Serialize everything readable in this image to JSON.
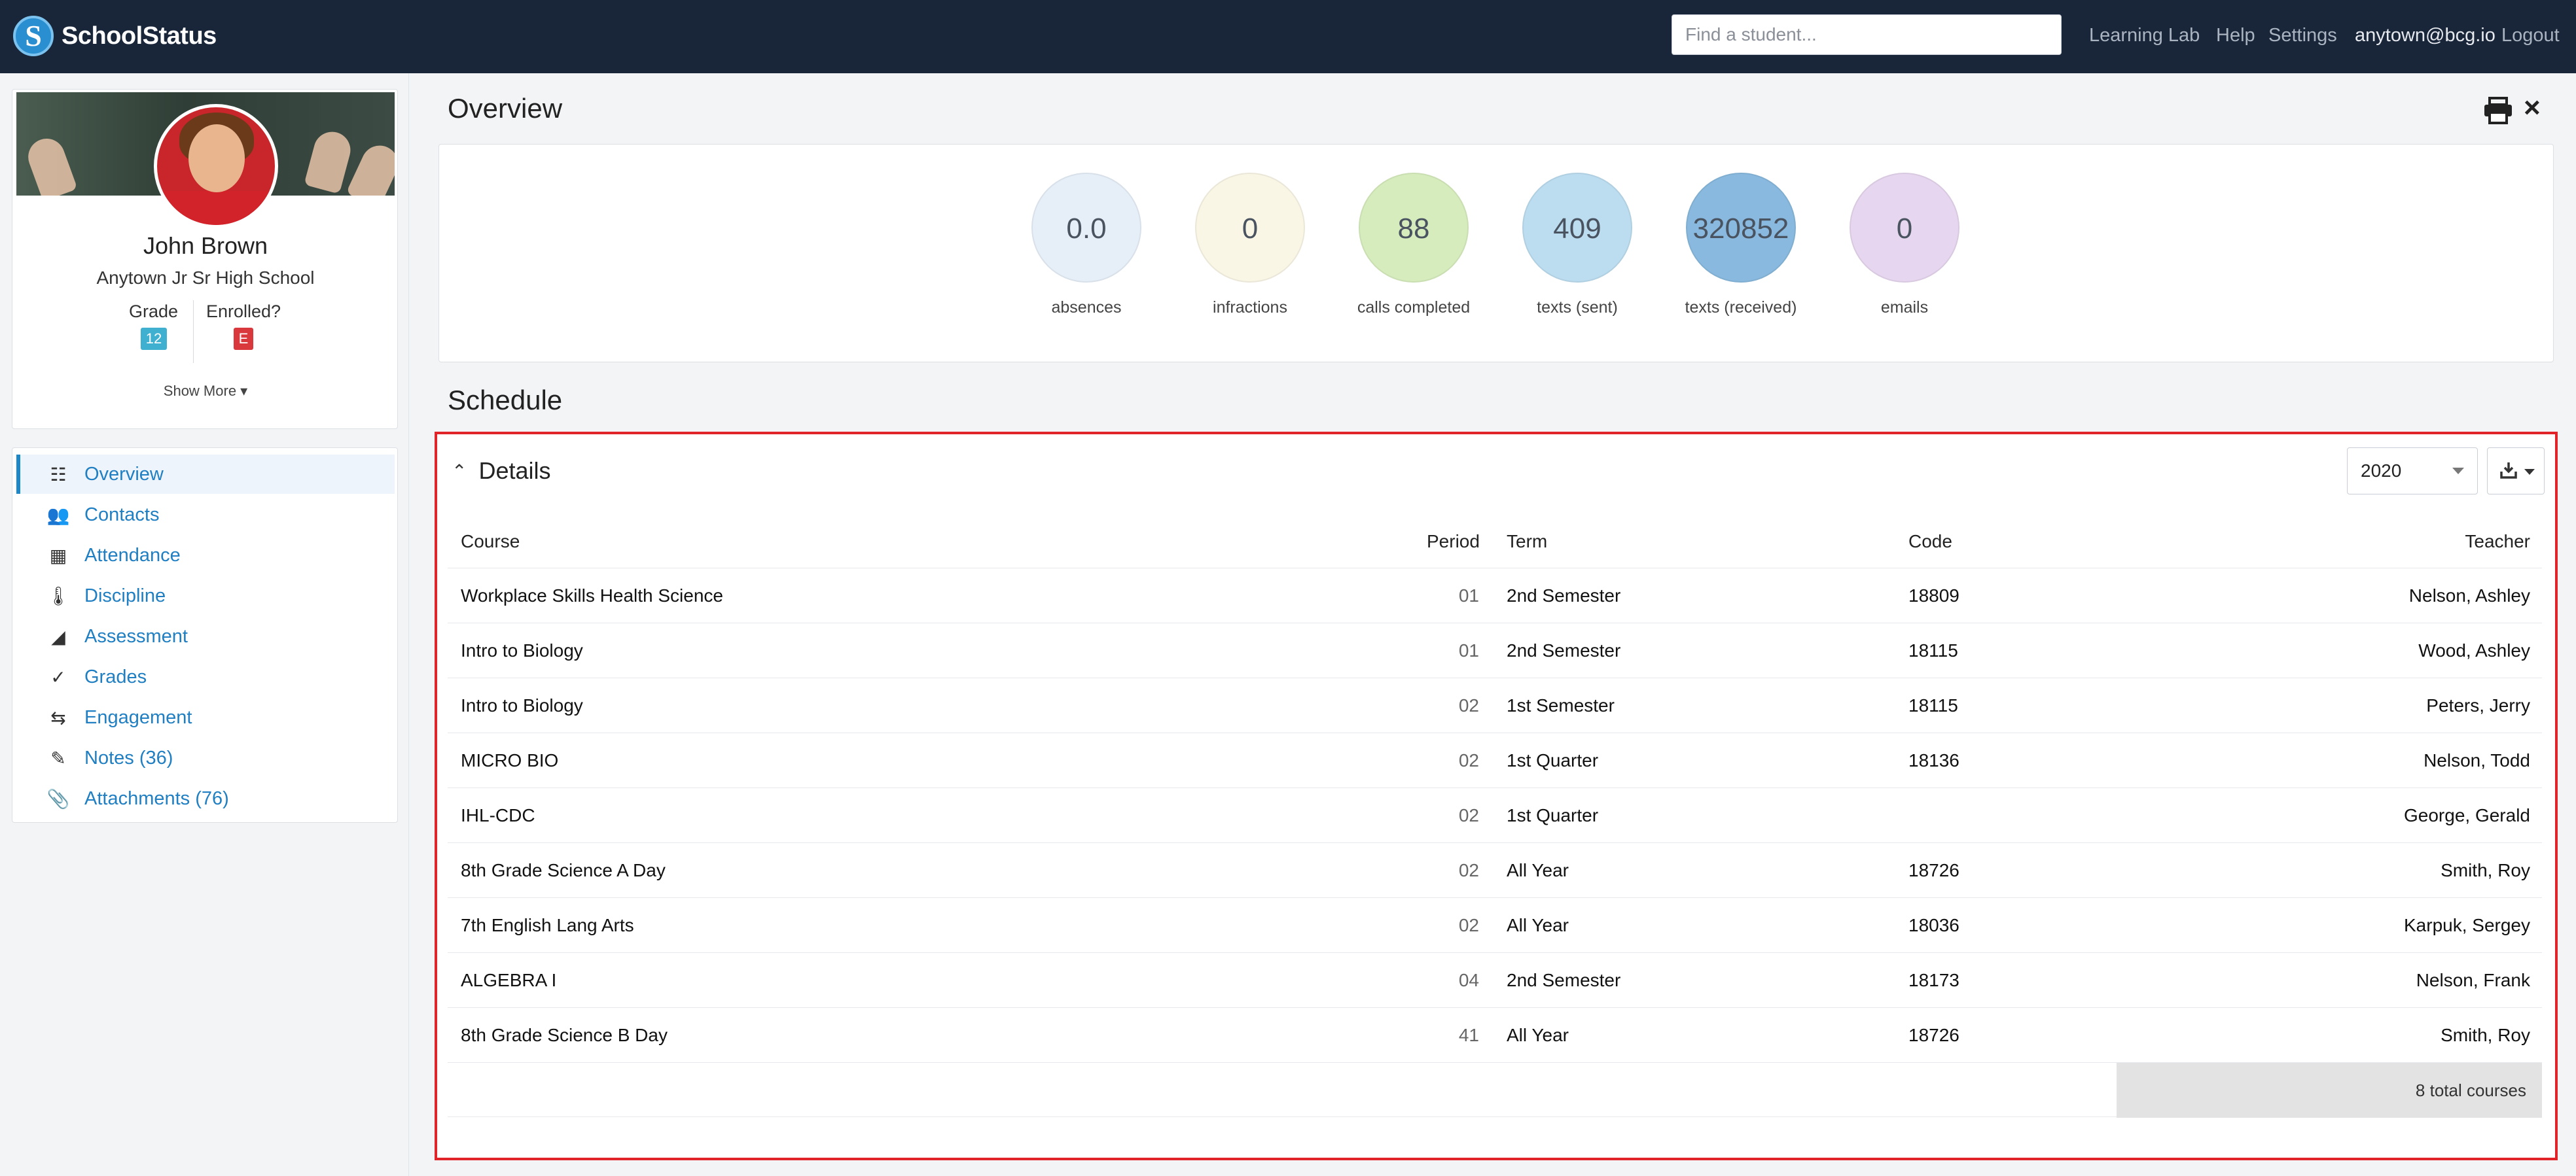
{
  "brand": {
    "name": "SchoolStatus"
  },
  "search": {
    "placeholder": "Find a student..."
  },
  "topnav": {
    "learning_lab": "Learning Lab",
    "help": "Help",
    "settings": "Settings",
    "user": "anytown@bcg.io",
    "logout": "Logout"
  },
  "student": {
    "name": "John Brown",
    "school": "Anytown Jr Sr High School",
    "grade_label": "Grade",
    "grade_value": "12",
    "enrolled_label": "Enrolled?",
    "enrolled_value": "E",
    "show_more": "Show More ▾"
  },
  "sidebar": {
    "items": [
      {
        "label": "Overview",
        "icon": "list-icon"
      },
      {
        "label": "Contacts",
        "icon": "contacts-icon"
      },
      {
        "label": "Attendance",
        "icon": "calendar-icon"
      },
      {
        "label": "Discipline",
        "icon": "thermometer-icon"
      },
      {
        "label": "Assessment",
        "icon": "chart-icon"
      },
      {
        "label": "Grades",
        "icon": "check-icon"
      },
      {
        "label": "Engagement",
        "icon": "arrows-icon"
      },
      {
        "label": "Notes (36)",
        "icon": "pencil-icon"
      },
      {
        "label": "Attachments (76)",
        "icon": "paperclip-icon"
      }
    ]
  },
  "overview": {
    "title": "Overview",
    "stats": [
      {
        "value": "0.0",
        "label": "absences",
        "color": "#e6eef8"
      },
      {
        "value": "0",
        "label": "infractions",
        "color": "#faf6e6"
      },
      {
        "value": "88",
        "label": "calls completed",
        "color": "#d6ecbd"
      },
      {
        "value": "409",
        "label": "texts (sent)",
        "color": "#bcdcf0"
      },
      {
        "value": "320852",
        "label": "texts (received)",
        "color": "#89b9de"
      },
      {
        "value": "0",
        "label": "emails",
        "color": "#e6d6ef"
      }
    ]
  },
  "schedule": {
    "title": "Schedule",
    "details_label": "Details",
    "year": "2020",
    "columns": {
      "course": "Course",
      "period": "Period",
      "term": "Term",
      "code": "Code",
      "teacher": "Teacher"
    },
    "rows": [
      {
        "course": "Workplace Skills Health Science",
        "period": "01",
        "term": "2nd Semester",
        "code": "18809",
        "teacher": "Nelson, Ashley"
      },
      {
        "course": "Intro to Biology",
        "period": "01",
        "term": "2nd Semester",
        "code": "18115",
        "teacher": "Wood, Ashley"
      },
      {
        "course": "Intro to Biology",
        "period": "02",
        "term": "1st Semester",
        "code": "18115",
        "teacher": "Peters, Jerry"
      },
      {
        "course": "MICRO BIO",
        "period": "02",
        "term": "1st Quarter",
        "code": "18136",
        "teacher": "Nelson, Todd"
      },
      {
        "course": "IHL-CDC",
        "period": "02",
        "term": "1st Quarter",
        "code": "",
        "teacher": "George, Gerald"
      },
      {
        "course": "8th Grade Science A Day",
        "period": "02",
        "term": "All Year",
        "code": "18726",
        "teacher": "Smith, Roy"
      },
      {
        "course": "7th English Lang Arts",
        "period": "02",
        "term": "All Year",
        "code": "18036",
        "teacher": "Karpuk, Sergey"
      },
      {
        "course": "ALGEBRA I",
        "period": "04",
        "term": "2nd Semester",
        "code": "18173",
        "teacher": "Nelson, Frank"
      },
      {
        "course": "8th Grade Science B Day",
        "period": "41",
        "term": "All Year",
        "code": "18726",
        "teacher": "Smith, Roy"
      }
    ],
    "total": "8 total courses"
  }
}
